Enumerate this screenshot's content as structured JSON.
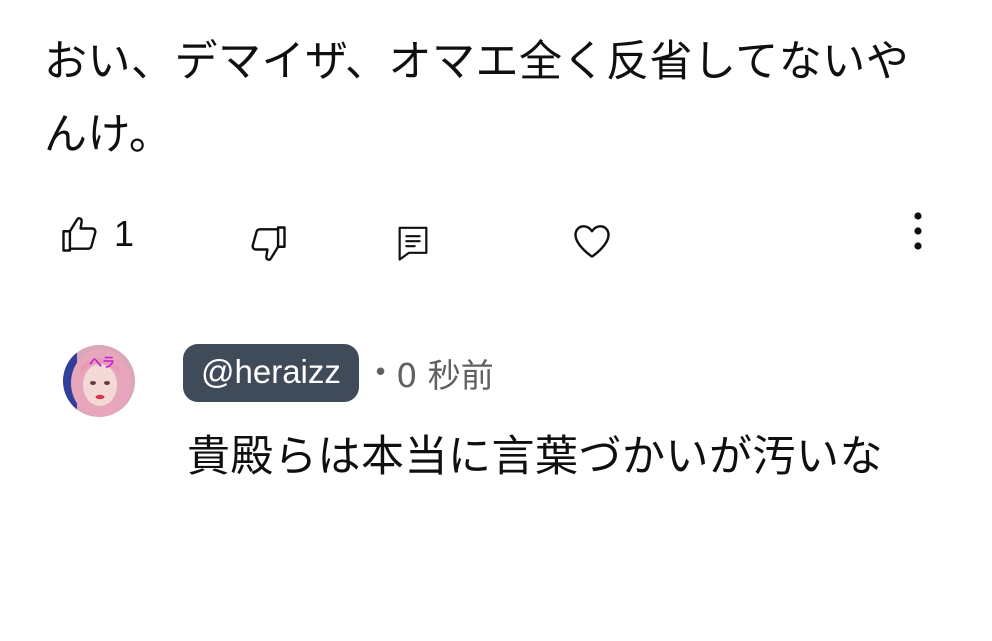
{
  "comment": {
    "text": "おい、デマイザ、オマエ全く反省してないやんけ。"
  },
  "actions": {
    "like_count": "1",
    "icons": [
      "thumbs-up-icon",
      "thumbs-down-icon",
      "reply-icon",
      "heart-icon",
      "more-vert-icon"
    ]
  },
  "reply": {
    "author_handle": "@heraizz",
    "separator": "•",
    "timestamp": "0 秒前",
    "text": "貴殿らは本当に言葉づかいが汚いな",
    "avatar_overlay_text": "ヘラ"
  },
  "colors": {
    "text": "#0f0f0f",
    "secondary_text": "#606060",
    "handle_badge_bg": "#3f4b58",
    "handle_badge_text": "#ffffff",
    "avatar_accent": "#c21fd6"
  }
}
